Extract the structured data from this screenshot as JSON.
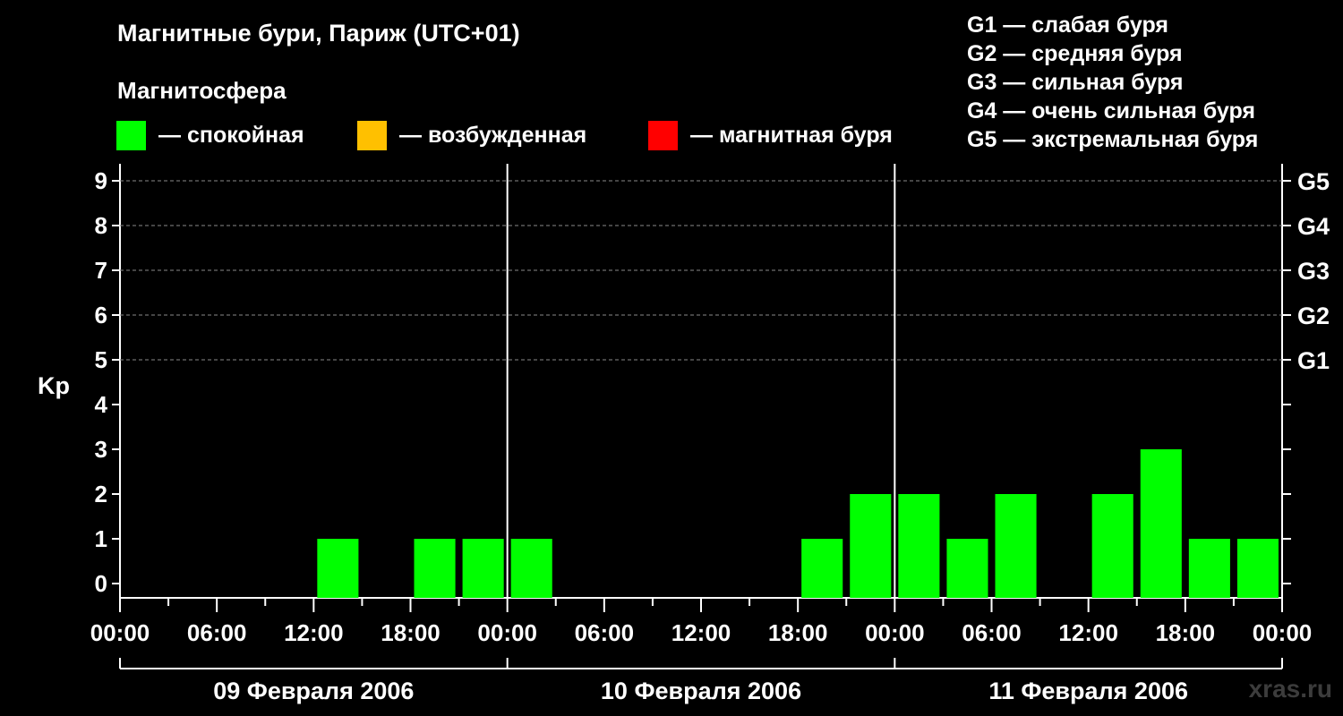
{
  "chart_data": {
    "type": "bar",
    "title": "Магнитные бури, Париж (UTC+01)",
    "legend_title": "Магнитосфера",
    "legend": [
      {
        "label": "— спокойная",
        "color": "#00ff00"
      },
      {
        "label": "— возбужденная",
        "color": "#ffc000"
      },
      {
        "label": "— магнитная буря",
        "color": "#ff0000"
      }
    ],
    "g_scale": [
      "G1 — слабая буря",
      "G2 — средняя буря",
      "G3 — сильная буря",
      "G4 — очень сильная буря",
      "G5 — экстремальная буря"
    ],
    "ylabel": "Kp",
    "ylim": [
      0,
      9
    ],
    "y_ticks": [
      "0",
      "1",
      "2",
      "3",
      "4",
      "5",
      "6",
      "7",
      "8",
      "9"
    ],
    "right_ticks": [
      {
        "kp": 5,
        "label": "G1"
      },
      {
        "kp": 6,
        "label": "G2"
      },
      {
        "kp": 7,
        "label": "G3"
      },
      {
        "kp": 8,
        "label": "G4"
      },
      {
        "kp": 9,
        "label": "G5"
      }
    ],
    "x_tick_labels": [
      "00:00",
      "06:00",
      "12:00",
      "18:00",
      "00:00",
      "06:00",
      "12:00",
      "18:00",
      "00:00",
      "06:00",
      "12:00",
      "18:00",
      "00:00"
    ],
    "days": [
      "09 Февраля 2006",
      "10 Февраля 2006",
      "11 Февраля 2006"
    ],
    "interval_hours": 3,
    "values": [
      0,
      0,
      0,
      0,
      1,
      0,
      1,
      1,
      1,
      0,
      0,
      0,
      0,
      0,
      1,
      2,
      2,
      1,
      2,
      0,
      2,
      3,
      1,
      1
    ],
    "bar_color": "#00ff00",
    "grid": true,
    "watermark": "xras.ru"
  }
}
